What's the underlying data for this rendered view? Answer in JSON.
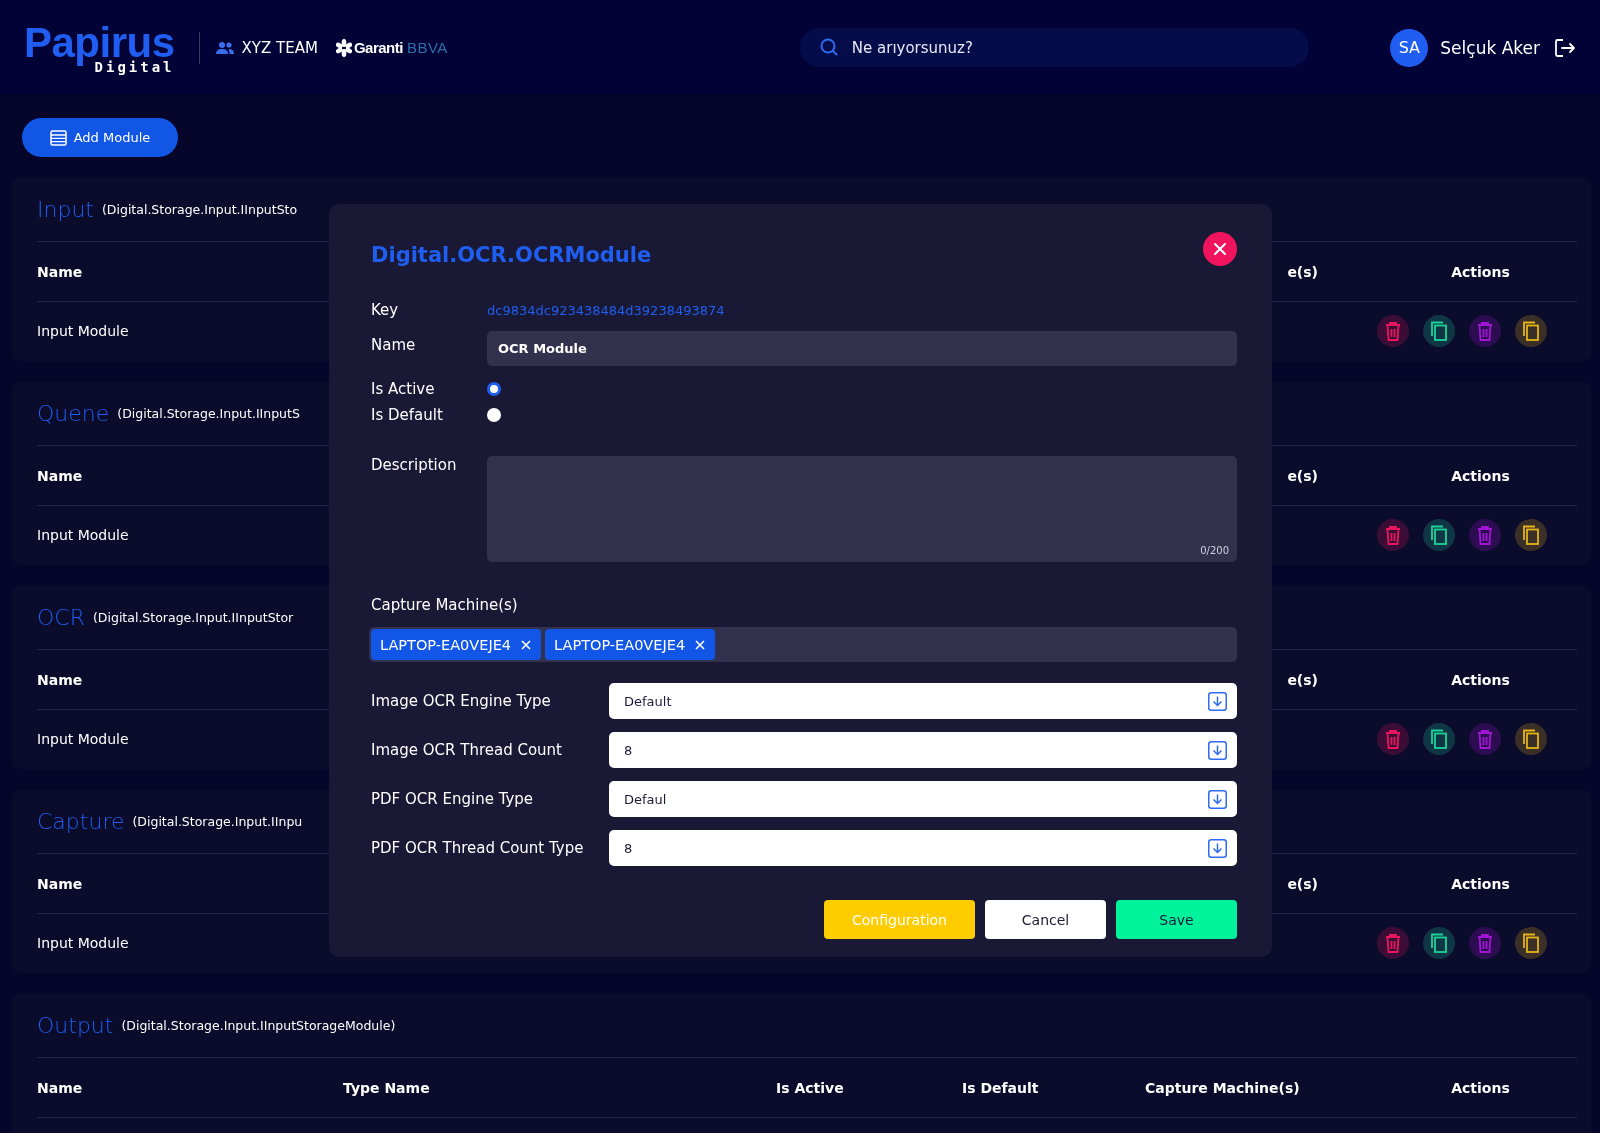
{
  "header": {
    "logo": {
      "main": "Papirus",
      "sub": "Digital"
    },
    "team": "XYZ TEAM",
    "partner": {
      "name": "Garanti",
      "suffix": "BBVA"
    },
    "search": {
      "placeholder": "Ne arıyorsunuz?"
    },
    "user": {
      "initials": "SA",
      "name": "Selçuk Aker"
    }
  },
  "add_button": "Add Module",
  "sections": [
    {
      "title": "Input",
      "subtitle": "(Digital.Storage.Input.IInputSto",
      "columns": [
        "Name",
        "e(s)",
        "Actions"
      ],
      "rows": [
        {
          "name": "Input Module",
          "actions": [
            {
              "kind": "delete",
              "color": "#e8175d"
            },
            {
              "kind": "copy",
              "color": "#1ed39b"
            },
            {
              "kind": "delete",
              "color": "#a515d6"
            },
            {
              "kind": "copy",
              "color": "#e6b417"
            }
          ]
        }
      ]
    },
    {
      "title": "Quene",
      "subtitle": "(Digital.Storage.Input.IInputS",
      "columns": [
        "Name",
        "e(s)",
        "Actions"
      ],
      "rows": [
        {
          "name": "Input Module",
          "actions": [
            {
              "kind": "delete",
              "color": "#e8175d"
            },
            {
              "kind": "copy",
              "color": "#1ed39b"
            },
            {
              "kind": "delete",
              "color": "#a515d6"
            },
            {
              "kind": "copy",
              "color": "#e6b417"
            }
          ]
        }
      ]
    },
    {
      "title": "OCR",
      "subtitle": "(Digital.Storage.Input.IInputStor",
      "columns": [
        "Name",
        "e(s)",
        "Actions"
      ],
      "rows": [
        {
          "name": "Input Module",
          "actions": [
            {
              "kind": "delete",
              "color": "#e8175d"
            },
            {
              "kind": "copy",
              "color": "#1ed39b"
            },
            {
              "kind": "delete",
              "color": "#a515d6"
            },
            {
              "kind": "copy",
              "color": "#e6b417"
            }
          ]
        }
      ]
    },
    {
      "title": "Capture",
      "subtitle": "(Digital.Storage.Input.IInpu",
      "columns": [
        "Name",
        "e(s)",
        "Actions"
      ],
      "rows": [
        {
          "name": "Input Module",
          "actions": [
            {
              "kind": "delete",
              "color": "#e8175d"
            },
            {
              "kind": "copy",
              "color": "#1ed39b"
            },
            {
              "kind": "delete",
              "color": "#a515d6"
            },
            {
              "kind": "copy",
              "color": "#e6b417"
            }
          ]
        }
      ]
    },
    {
      "title": "Output",
      "subtitle": "(Digital.Storage.Input.IInputStorageModule)",
      "columns": [
        "Name",
        "Type Name",
        "Is Active",
        "Is Default",
        "Capture Machine(s)",
        "Actions"
      ]
    }
  ],
  "modal": {
    "title": "Digital.OCR.OCRModule",
    "key": {
      "label": "Key",
      "value": "dc9834dc923438484d39238493874"
    },
    "name": {
      "label": "Name",
      "value": "OCR Module"
    },
    "toggles": [
      {
        "label": "Is Active",
        "selected": true
      },
      {
        "label": "Is Default",
        "selected": false
      }
    ],
    "description": {
      "label": "Description",
      "counter": "0/200"
    },
    "capture": {
      "label": "Capture Machine(s)",
      "tags": [
        "LAPTOP-EA0VEJE4",
        "LAPTOP-EA0VEJE4"
      ]
    },
    "selects": [
      {
        "label": "Image OCR Engine Type",
        "value": "Default"
      },
      {
        "label": "Image OCR Thread Count",
        "value": "8"
      },
      {
        "label": "PDF OCR Engine Type",
        "value": "Defaul"
      },
      {
        "label": "PDF OCR Thread Count Type",
        "value": "8"
      }
    ],
    "buttons": [
      {
        "label": "Configuration",
        "kind": "config"
      },
      {
        "label": "Cancel",
        "kind": "cancel"
      },
      {
        "label": "Save",
        "kind": "save"
      }
    ]
  }
}
